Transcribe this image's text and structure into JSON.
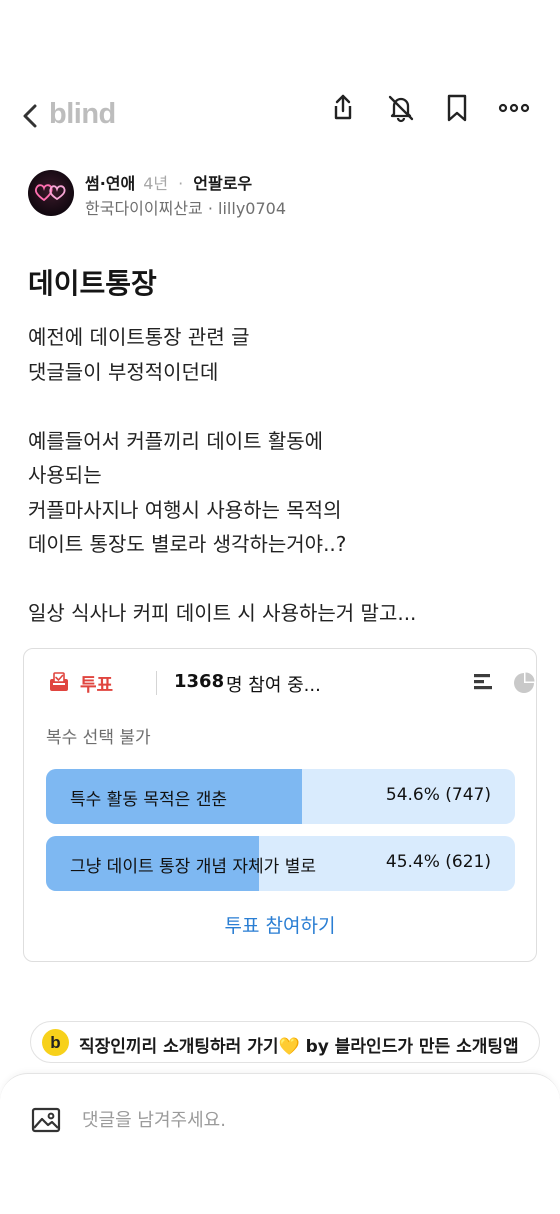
{
  "header": {
    "logo": "blind",
    "icons": [
      "back-chevron-icon",
      "share-icon",
      "notification-off-icon",
      "bookmark-icon",
      "more-icon"
    ]
  },
  "post": {
    "category": "썸·연애",
    "age": "4년",
    "follow_label": "언팔로우",
    "company": "한국다이이찌산쿄",
    "username": "lilly0704",
    "title": "데이트통장",
    "body": "예전에 데이트통장 관련 글\n댓글들이 부정적이던데\n\n예를들어서 커플끼리 데이트 활동에\n사용되는\n커플마사지나 여행시 사용하는 목적의\n데이트 통장도 별로라 생각하는거야..?\n\n일상 식사나 커피 데이트 시 사용하는거 말고..."
  },
  "poll": {
    "label": "투표",
    "count": "1368",
    "count_suffix": "명 참여 중...",
    "note": "복수 선택 불가",
    "options": [
      {
        "text": "특수 활동 목적은 갠춘",
        "percent": 54.6,
        "result": "54.6% (747)"
      },
      {
        "text": "그냥 데이트 통장 개념 자체가 별로",
        "percent": 45.4,
        "result": "45.4% (621)"
      }
    ],
    "cta": "투표 참여하기",
    "colors": {
      "fill": "#7eb8f2",
      "track": "#d9ebfd",
      "accent": "#e0453f",
      "link": "#2a7ed3"
    }
  },
  "banner": {
    "badge": "b",
    "text": "직장인끼리 소개팅하러 가기💛 by 블라인드가 만든 소개팅앱"
  },
  "composer": {
    "placeholder": "댓글을 남겨주세요."
  }
}
